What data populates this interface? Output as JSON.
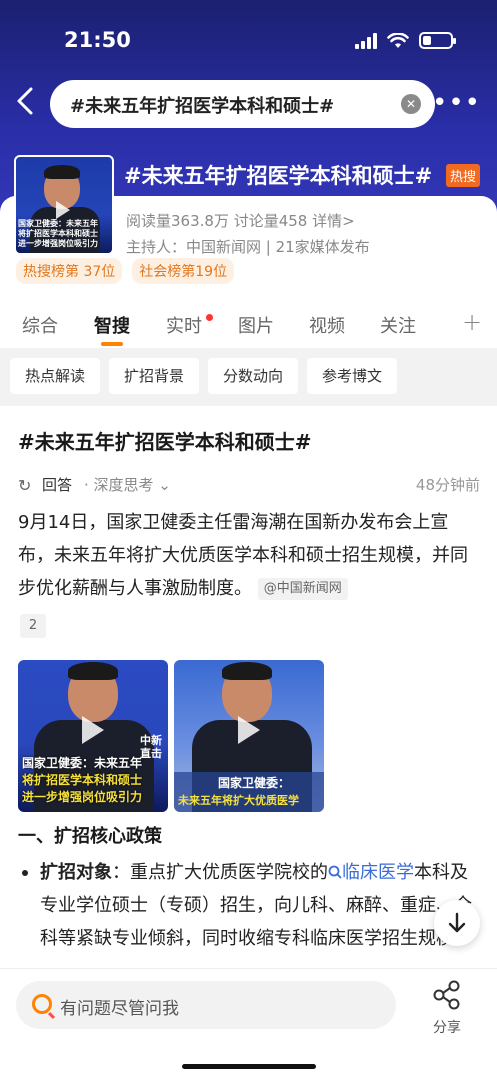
{
  "status_bar": {
    "time": "21:50"
  },
  "search": {
    "query": "#未来五年扩招医学本科和硕士#"
  },
  "topic": {
    "title": "#未来五年扩招医学本科和硕士#",
    "hot_tag": "热搜",
    "stats": "阅读量363.8万  讨论量458  详情>",
    "host": "主持人：中国新闻网 | 21家媒体发布",
    "ranks": [
      "热搜榜第 37位",
      "社会榜第19位"
    ],
    "thumb_caption": [
      "国家卫健委：未来五年",
      "将扩招医学本科和硕士",
      "进一步增强岗位吸引力"
    ]
  },
  "tabs": [
    "综合",
    "智搜",
    "实时",
    "图片",
    "视频",
    "关注"
  ],
  "chips": [
    "热点解读",
    "扩招背景",
    "分数动向",
    "参考博文"
  ],
  "content": {
    "title": "#未来五年扩招医学本科和硕士#",
    "answer_label": "回答",
    "answer_mode": "· 深度思考 ⌄",
    "time_ago": "48分钟前",
    "paragraph": "9月14日，国家卫健委主任雷海潮在国新办发布会上宣布，未来五年将扩大优质医学本科和硕士招生规模，并同步优化薪酬与人事激励制度。",
    "source": "@中国新闻网",
    "cite_count": "2",
    "video1_caption": [
      "国家卫健委：未来五年",
      "将扩招医学本科和硕士",
      "进一步增强岗位吸引力"
    ],
    "video1_logo": [
      "中新",
      "直击"
    ],
    "video2_caption": [
      "国家卫健委：",
      "未来五年将扩大优质医学"
    ],
    "section_heading": "一、扩招核心政策",
    "bullet_label": "扩招对象",
    "bullet_pre": "：重点扩大优质医学院校的",
    "bullet_link": "临床医学",
    "bullet_post": "本科及专业学位硕士（专硕）招生，向儿科、麻醉、重症、全科等紧缺专业倾斜，同时收缩专科临床医学招生规模。"
  },
  "bottom": {
    "ask_placeholder": "有问题尽管问我",
    "share_label": "分享"
  },
  "colors": {
    "accent": "#ff8200",
    "header_blue": "#2a2ea8",
    "hot": "#f26a21",
    "link": "#3a6cd8"
  }
}
